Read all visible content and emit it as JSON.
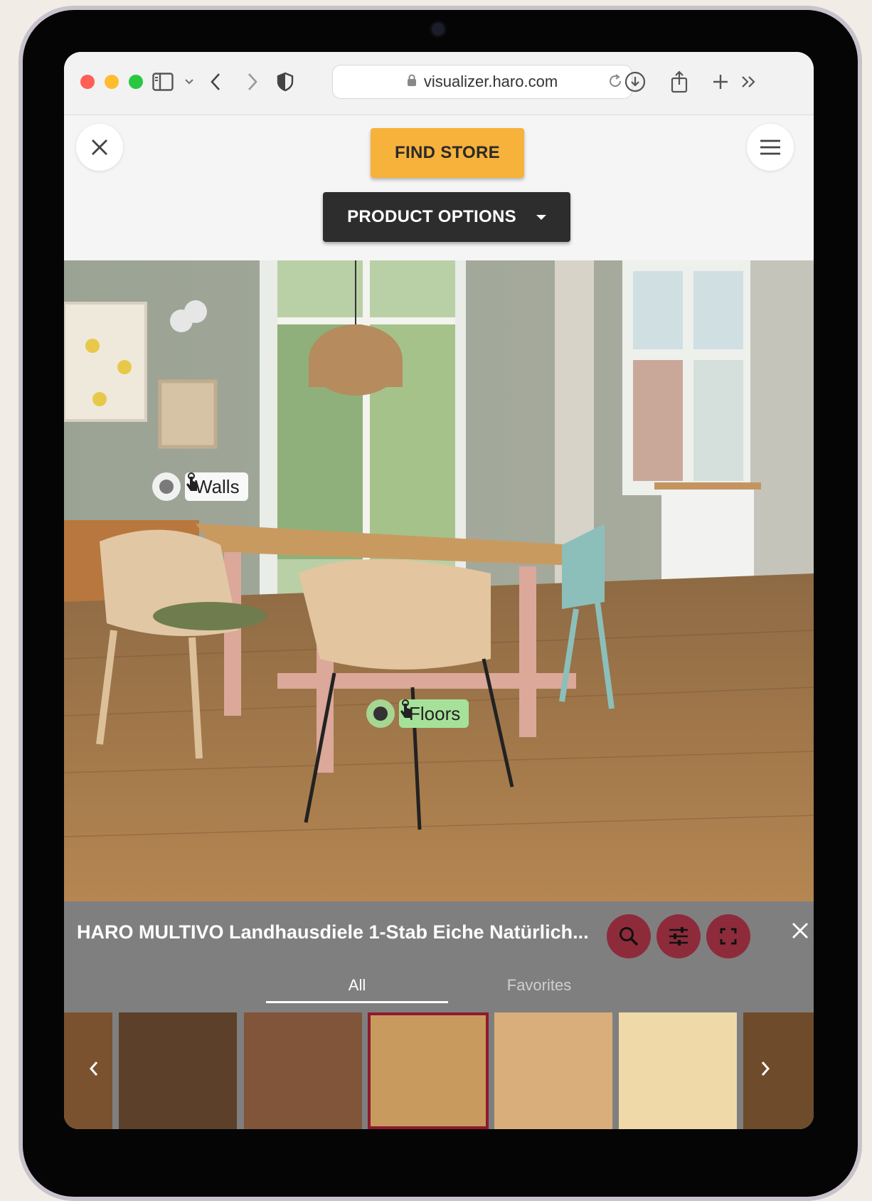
{
  "browser": {
    "url": "visualizer.haro.com"
  },
  "header": {
    "find_store_label": "FIND STORE",
    "product_options_label": "PRODUCT OPTIONS"
  },
  "hotspots": {
    "walls_label": "Walls",
    "floors_label": "Floors"
  },
  "product_panel": {
    "title": "HARO MULTIVO Landhausdiele 1-Stab Eiche Natürlich...",
    "tabs": [
      "All",
      "Favorites"
    ],
    "active_tab": "All",
    "selected_swatch_index": 3,
    "swatch_colors": [
      "#7a5230",
      "#5c4029",
      "#80553a",
      "#c89a5e",
      "#d9ae7b",
      "#efd9a8",
      "#6e4b2a"
    ]
  },
  "colors": {
    "accent_store": "#f7b23b",
    "dark_button": "#2d2d2d",
    "action_button": "#8e2b3b",
    "floors_highlight": "#a6e19a"
  }
}
